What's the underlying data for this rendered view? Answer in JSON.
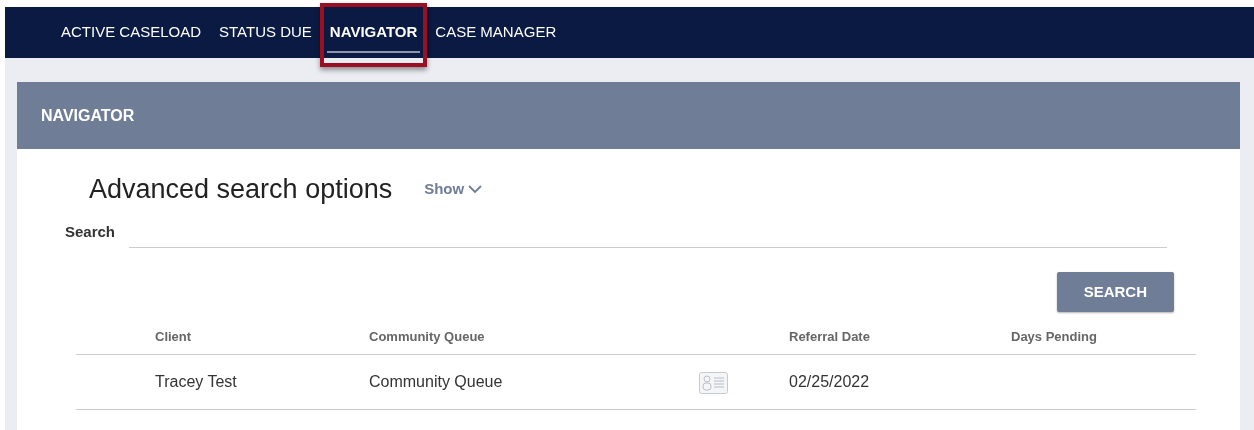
{
  "tabs": [
    {
      "label": "ACTIVE CASELOAD",
      "selected": false,
      "highlighted": false
    },
    {
      "label": "STATUS DUE",
      "selected": false,
      "highlighted": false
    },
    {
      "label": "NAVIGATOR",
      "selected": true,
      "highlighted": true
    },
    {
      "label": "CASE MANAGER",
      "selected": false,
      "highlighted": false
    }
  ],
  "panel": {
    "title": "NAVIGATOR"
  },
  "advanced": {
    "title": "Advanced search options",
    "toggle": "Show",
    "expanded": false
  },
  "search": {
    "label": "Search",
    "button": "SEARCH"
  },
  "table": {
    "columns": [
      "Client",
      "Community Queue",
      "",
      "Referral Date",
      "Days Pending"
    ],
    "rows": [
      {
        "client": "Tracey Test",
        "queue": "Community Queue",
        "referral_date": "02/25/2022"
      }
    ]
  }
}
